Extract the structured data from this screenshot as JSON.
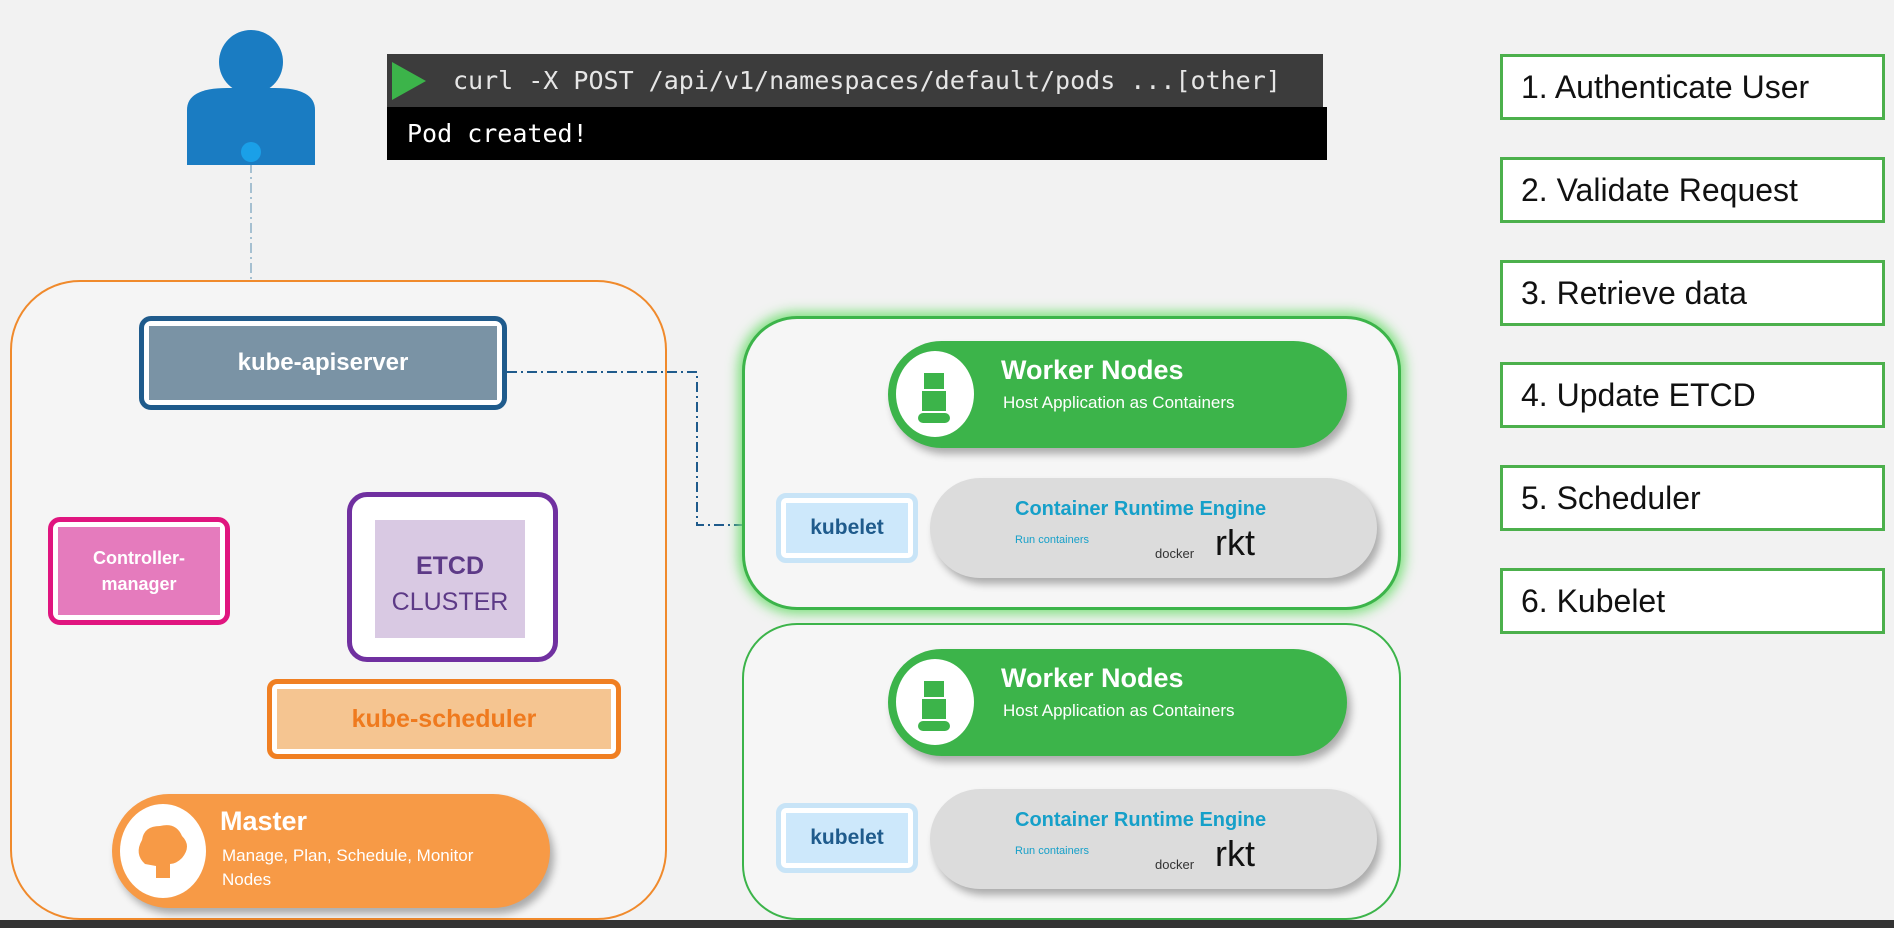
{
  "terminal": {
    "command": "curl -X POST /api/v1/namespaces/default/pods ...[other]",
    "output": "Pod created!"
  },
  "steps": [
    "1. Authenticate User",
    "2. Validate Request",
    "3. Retrieve data",
    "4. Update ETCD",
    "5. Scheduler",
    "6. Kubelet"
  ],
  "master": {
    "apiserver": "kube-apiserver",
    "controller": "Controller-manager",
    "etcd_line1": "ETCD",
    "etcd_line2": "CLUSTER",
    "scheduler": "kube-scheduler",
    "title": "Master",
    "subtitle": "Manage, Plan, Schedule, Monitor Nodes"
  },
  "workers": [
    {
      "title": "Worker Nodes",
      "subtitle": "Host Application as Containers",
      "kubelet": "kubelet",
      "cre_title": "Container Runtime Engine",
      "cre_sub": "Run containers",
      "docker": "docker",
      "rkt": "rkt",
      "highlighted": true
    },
    {
      "title": "Worker Nodes",
      "subtitle": "Host Application as Containers",
      "kubelet": "kubelet",
      "cre_title": "Container Runtime Engine",
      "cre_sub": "Run containers",
      "docker": "docker",
      "rkt": "rkt",
      "highlighted": false
    }
  ],
  "colors": {
    "accent_green": "#3cb44a",
    "master_orange": "#f79a46",
    "apiserver_blue": "#1f5b8c",
    "user_blue": "#1a7cc2"
  }
}
